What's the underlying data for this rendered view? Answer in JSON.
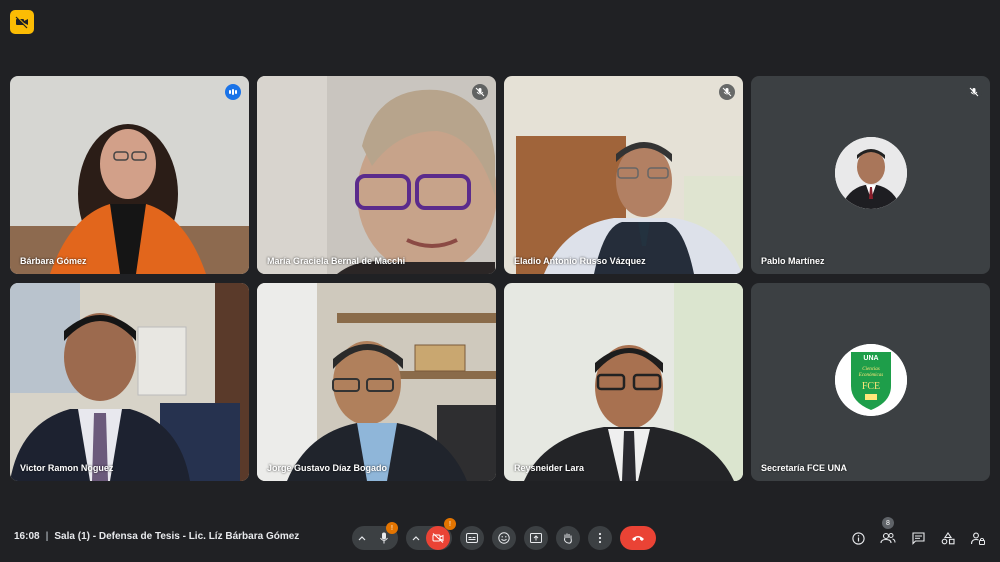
{
  "participants": [
    {
      "name": "Bárbara Gómez",
      "status": "speaking"
    },
    {
      "name": "María Graciela Bernal de Macchi",
      "status": "muted"
    },
    {
      "name": "Eladio Antonio Russo Vázquez",
      "status": "muted"
    },
    {
      "name": "Pablo Martínez",
      "status": "muted"
    },
    {
      "name": "Victor Ramon Noguez",
      "status": ""
    },
    {
      "name": "Jorge Gustavo Díaz Bogado",
      "status": ""
    },
    {
      "name": "Reysneider Lara",
      "status": ""
    },
    {
      "name": "Secretaría FCE UNA",
      "status": ""
    }
  ],
  "logo": {
    "line1": "UNA",
    "line2": "Ciencias",
    "line3": "Económicas",
    "line4": "FCE"
  },
  "bottom_bar": {
    "time": "16:08",
    "meeting_title": "Sala (1) - Defensa de Tesis - Lic. Líz Bárbara Gómez",
    "mic_alert": "!",
    "cam_alert": "!",
    "people_count": "8"
  },
  "colors": {
    "background": "#202124",
    "tile": "#3c4043",
    "end_call": "#ea4335",
    "accent": "#1a73e8",
    "rec": "#fbbc04"
  }
}
